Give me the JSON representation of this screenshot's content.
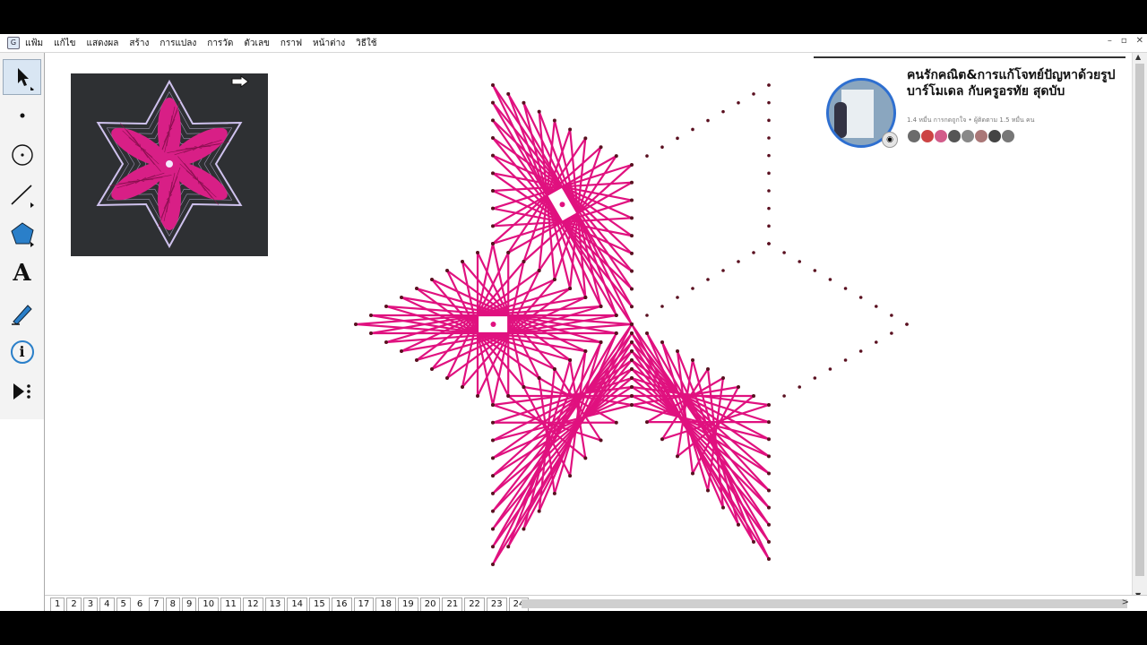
{
  "menu": [
    "แฟ้ม",
    "แก้ไข",
    "แสดงผล",
    "สร้าง",
    "การแปลง",
    "การวัด",
    "ตัวเลข",
    "กราฟ",
    "หน้าต่าง",
    "วิธีใช้"
  ],
  "window_controls": [
    "–",
    "▫",
    "✕"
  ],
  "tools": [
    "arrow-tool",
    "point-tool",
    "compass-tool",
    "line-tool",
    "polygon-tool",
    "text-tool",
    "marker-tool",
    "information-tool",
    "custom-tool"
  ],
  "text_tool_glyph": "A",
  "info_tool_glyph": "i",
  "overlay": {
    "title": "คนรักคณิต&การแก้โจทย์ปัญหาด้วยรูปบาร์โมเดล กับครูอรทัย สุดบับ",
    "subtitle": "1.4 หมื่น การกดถูกใจ • ผู้ติดตาม 1.5 หมื่น คน"
  },
  "pages": [
    "1",
    "2",
    "3",
    "4",
    "5",
    "6",
    "7",
    "8",
    "9",
    "10",
    "11",
    "12",
    "13",
    "14",
    "15",
    "16",
    "17",
    "18",
    "19",
    "20",
    "21",
    "22",
    "23",
    "24"
  ],
  "active_page": "6",
  "colors": {
    "thread": "#e0117f",
    "nail": "#5a1020",
    "photo_bg": "#2e3033",
    "photo_thread": "#d81f86",
    "photo_outline": "#cfc2ee"
  }
}
